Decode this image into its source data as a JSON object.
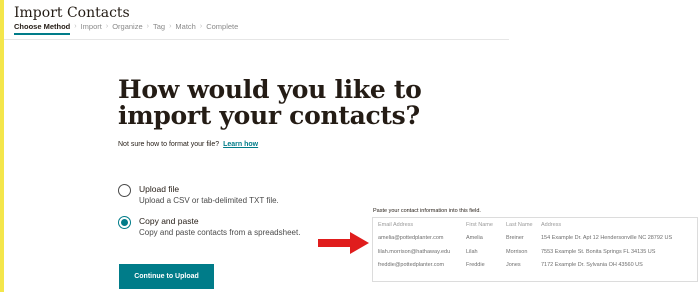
{
  "header": {
    "title": "Import Contacts",
    "steps": [
      "Choose Method",
      "Import",
      "Organize",
      "Tag",
      "Match",
      "Complete"
    ],
    "separator": "›"
  },
  "main": {
    "question": "How would you like to import your contacts?",
    "format_help": "Not sure how to format your file?",
    "learn_link": "Learn how",
    "options": [
      {
        "title": "Upload file",
        "description": "Upload a CSV or tab-delimited TXT file.",
        "selected": false
      },
      {
        "title": "Copy and paste",
        "description": "Copy and paste contacts from a spreadsheet.",
        "selected": true
      }
    ],
    "continue_label": "Continue to Upload"
  },
  "paste_area": {
    "label": "Paste your contact information into this field.",
    "headers": [
      "Email Address",
      "First Name",
      "Last Name",
      "Address"
    ],
    "rows": [
      [
        "amelia@pottedplanter.com",
        "Amelia",
        "Breiner",
        "154 Example Dr. Apt 12 Hendersonville NC 28792 US"
      ],
      [
        "lilah.morrison@hathaway.edu",
        "Lilah",
        "Morrison",
        "7553 Example St. Bonita Springs FL 34135 US"
      ],
      [
        "freddie@pottedplanter.com",
        "Freddie",
        "Jones",
        "7172 Example Dr. Sylvania OH 43560 US"
      ]
    ]
  },
  "colors": {
    "accent": "#007c89",
    "annotation_arrow": "#e01d1d",
    "left_accent": "#f4e64b"
  },
  "icons": {
    "annotation": "arrow-right-icon"
  }
}
